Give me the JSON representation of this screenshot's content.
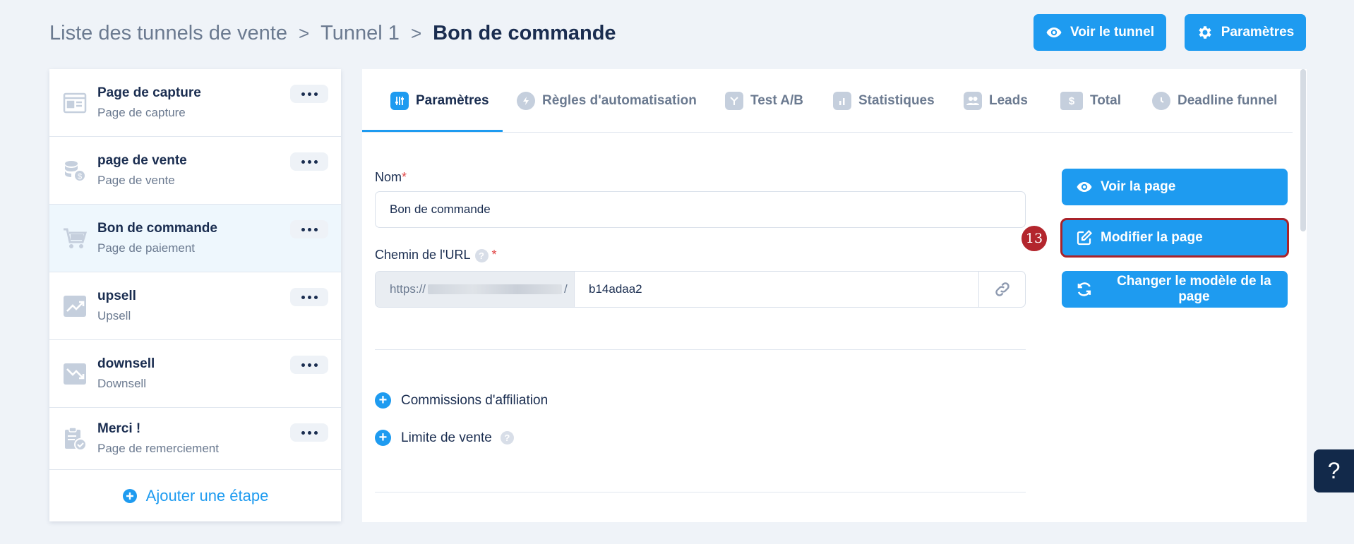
{
  "breadcrumb": {
    "items": [
      "Liste des tunnels de vente",
      "Tunnel 1",
      "Bon de commande"
    ],
    "separator": ">"
  },
  "header_buttons": {
    "view_funnel": "Voir le tunnel",
    "settings": "Paramètres"
  },
  "sidebar": {
    "steps": [
      {
        "title": "Page de capture",
        "subtitle": "Page de capture",
        "icon": "capture-page-icon"
      },
      {
        "title": "page de vente",
        "subtitle": "Page de vente",
        "icon": "coins-icon"
      },
      {
        "title": "Bon de commande",
        "subtitle": "Page de paiement",
        "icon": "cart-icon",
        "active": true
      },
      {
        "title": "upsell",
        "subtitle": "Upsell",
        "icon": "trend-up-icon"
      },
      {
        "title": "downsell",
        "subtitle": "Downsell",
        "icon": "trend-down-icon"
      },
      {
        "title": "Merci !",
        "subtitle": "Page de remerciement",
        "icon": "clipboard-check-icon"
      }
    ],
    "add_step": "Ajouter une étape"
  },
  "tabs": [
    {
      "label": "Paramètres",
      "icon": "sliders-icon",
      "active": true
    },
    {
      "label": "Règles d'automatisation",
      "icon": "bolt-icon"
    },
    {
      "label": "Test A/B",
      "icon": "split-icon"
    },
    {
      "label": "Statistiques",
      "icon": "bar-chart-icon"
    },
    {
      "label": "Leads",
      "icon": "users-icon"
    },
    {
      "label": "Total",
      "icon": "dollar-icon"
    },
    {
      "label": "Deadline funnel",
      "icon": "clock-icon"
    }
  ],
  "form": {
    "name_label": "Nom",
    "name_value": "Bon de commande",
    "url_label": "Chemin de l'URL",
    "url_prefix_start": "https://",
    "url_prefix_end": "/",
    "url_slug": "b14adaa2",
    "required_mark": "*",
    "help_mark": "?"
  },
  "options": {
    "affiliate_commissions": "Commissions d'affiliation",
    "sales_limit": "Limite de vente"
  },
  "page_actions": {
    "view_page": "Voir la page",
    "edit_page": "Modifier la page",
    "change_template": "Changer le modèle de la page"
  },
  "annotation_marker": "13",
  "help_button": "?",
  "colors": {
    "primary": "#1e9bf0",
    "navy": "#1a2d50",
    "highlight": "#a8232a"
  }
}
